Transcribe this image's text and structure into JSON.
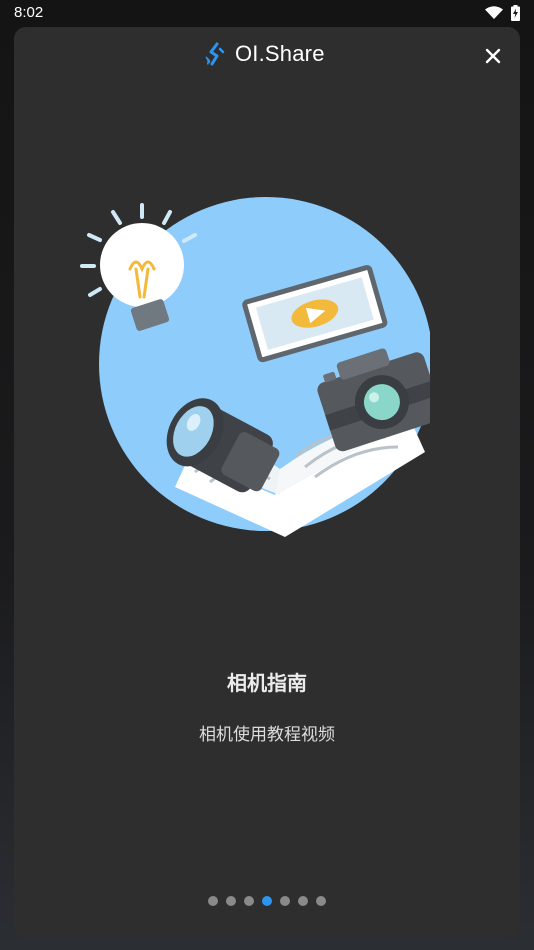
{
  "status_bar": {
    "time": "8:02",
    "icons": [
      "wifi-icon",
      "battery-charging-icon"
    ]
  },
  "header": {
    "app_name": "OI.Share",
    "logo_icon": "oi-share-logo-icon",
    "close_icon": "close-icon"
  },
  "slide": {
    "illustration": "camera-guide-illustration",
    "title": "相机指南",
    "subtitle": "相机使用教程视频"
  },
  "pagination": {
    "total": 7,
    "current": 4
  },
  "colors": {
    "card_bg": "#2e2e2e",
    "accent": "#2d95f0",
    "circle_bg": "#8ecdfb",
    "inactive_dot": "#8a8a8a"
  }
}
